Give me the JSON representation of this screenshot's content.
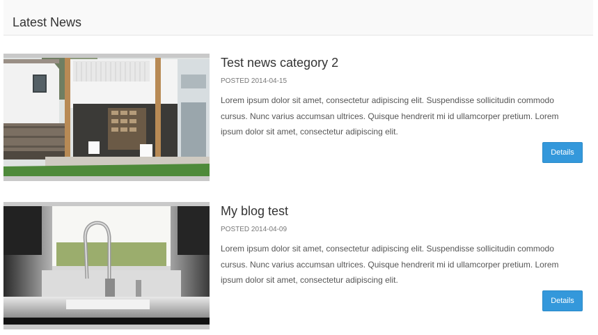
{
  "panel": {
    "title": "Latest News"
  },
  "news": [
    {
      "title": "Test news category 2",
      "posted_label": "POSTED",
      "date": "2014-04-15",
      "body": "Lorem ipsum dolor sit amet, consectetur adipiscing elit. Suspendisse sollicitudin commodo cursus. Nunc varius accumsan ultrices. Quisque hendrerit mi id ullamcorper pretium. Lorem ipsum dolor sit amet, consectetur adipiscing elit.",
      "button_label": "Details",
      "image": "house-exterior-photo"
    },
    {
      "title": "My blog test",
      "posted_label": "POSTED",
      "date": "2014-04-09",
      "body": "Lorem ipsum dolor sit amet, consectetur adipiscing elit. Suspendisse sollicitudin commodo cursus. Nunc varius accumsan ultrices. Quisque hendrerit mi id ullamcorper pretium. Lorem ipsum dolor sit amet, consectetur adipiscing elit.",
      "button_label": "Details",
      "image": "kitchen-sink-photo"
    }
  ],
  "colors": {
    "button": "#3498db",
    "title": "#333333",
    "body": "#555555",
    "meta": "#777777",
    "header_bg": "#f9f9f9"
  }
}
